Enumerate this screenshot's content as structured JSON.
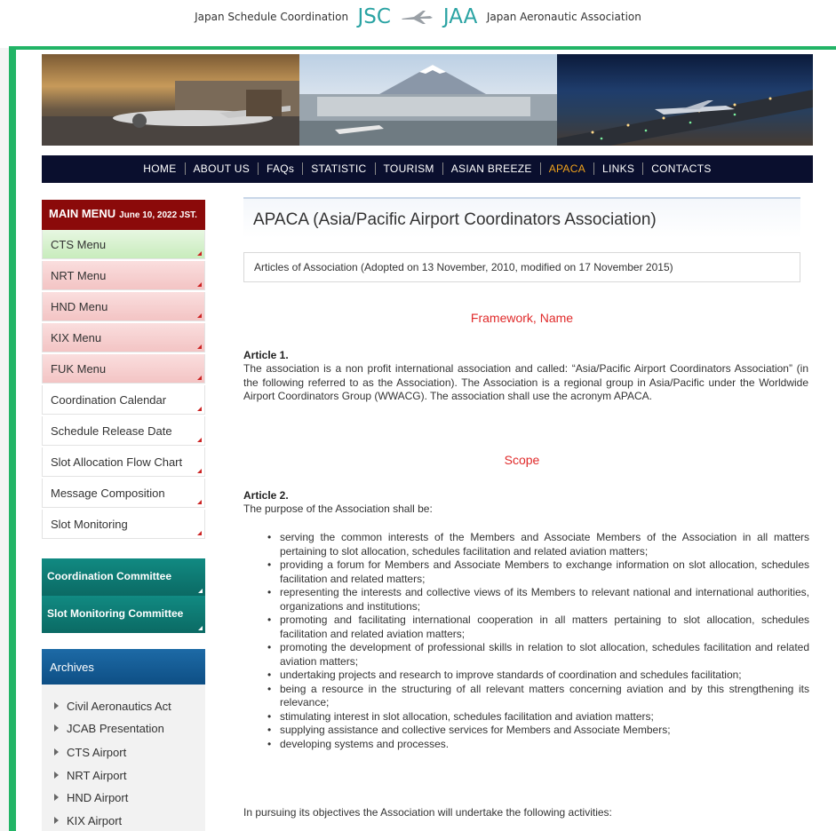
{
  "header": {
    "left_text": "Japan Schedule Coordination",
    "jsc": "JSC",
    "jaa": "JAA",
    "right_text": "Japan Aeronautic Association"
  },
  "nav": [
    "HOME",
    "ABOUT US",
    "FAQs",
    "STATISTIC",
    "TOURISM",
    "ASIAN BREEZE",
    "APACA",
    "LINKS",
    "CONTACTS"
  ],
  "nav_active": "APACA",
  "sidebar": {
    "main_menu": "MAIN MENU",
    "date": "June 10, 2022 JST.",
    "items": [
      "CTS Menu",
      "NRT Menu",
      "HND Menu",
      "KIX Menu",
      "FUK Menu",
      "Coordination Calendar",
      "Schedule Release Date",
      "Slot Allocation Flow Chart",
      "Message Composition",
      "Slot Monitoring"
    ],
    "committees": [
      "Coordination Committee",
      "Slot Monitoring Committee"
    ],
    "archives_title": "Archives",
    "archives": [
      "Civil Aeronautics Act",
      "JCAB Presentation",
      "CTS Airport",
      "NRT Airport",
      "HND Airport",
      "KIX Airport"
    ]
  },
  "content": {
    "title": "APACA (Asia/Pacific Airport Coordinators Association)",
    "articles_intro": "Articles of Association (Adopted on 13 November, 2010, modified on 17 November 2015)",
    "section1": "Framework, Name",
    "article1_title": "Article 1.",
    "article1_text": "The association is a non profit international association and called: “Asia/Pacific Airport Coordinators Association” (in the following referred to as the Association). The Association is a regional group in Asia/Pacific under the Worldwide Airport Coordinators Group (WWACG). The association shall use the acronym APACA.",
    "section2": "Scope",
    "article2_title": "Article 2.",
    "article2_intro": "The purpose of the Association shall be:",
    "purposes": [
      "serving the common interests of the Members and Associate Members of the Association in all matters pertaining to slot allocation, schedules facilitation and related aviation matters;",
      "providing a forum for Members and Associate Members to exchange information on slot allocation, schedules facilitation and related matters;",
      "representing the interests and collective views of its Members to relevant national and international authorities, organizations and institutions;",
      "promoting and facilitating international cooperation in all matters pertaining to slot allocation, schedules facilitation and related aviation matters;",
      "promoting the development of professional skills in relation to slot allocation, schedules facilitation and related aviation matters;",
      "undertaking projects and research to improve standards of coordination and schedules facilitation;",
      "being a resource in the structuring of all relevant matters concerning aviation and by this strengthening its relevance;",
      "stimulating interest in slot allocation, schedules facilitation and aviation matters;",
      "supplying assistance and collective services for Members and Associate Members;",
      "developing systems and processes."
    ],
    "activities_intro": "In pursuing its objectives the Association will undertake the following activities:"
  },
  "colors": {
    "accent_green": "#22b466",
    "jsc_teal": "#2aa3a3",
    "nav_bg": "#0a0f2e",
    "nav_active": "#f0a21b",
    "main_menu_bg": "#8b0a0a",
    "committee_bg": "#0b6a64",
    "archives_bg": "#0e4f85",
    "section_red": "#e02a2a"
  }
}
